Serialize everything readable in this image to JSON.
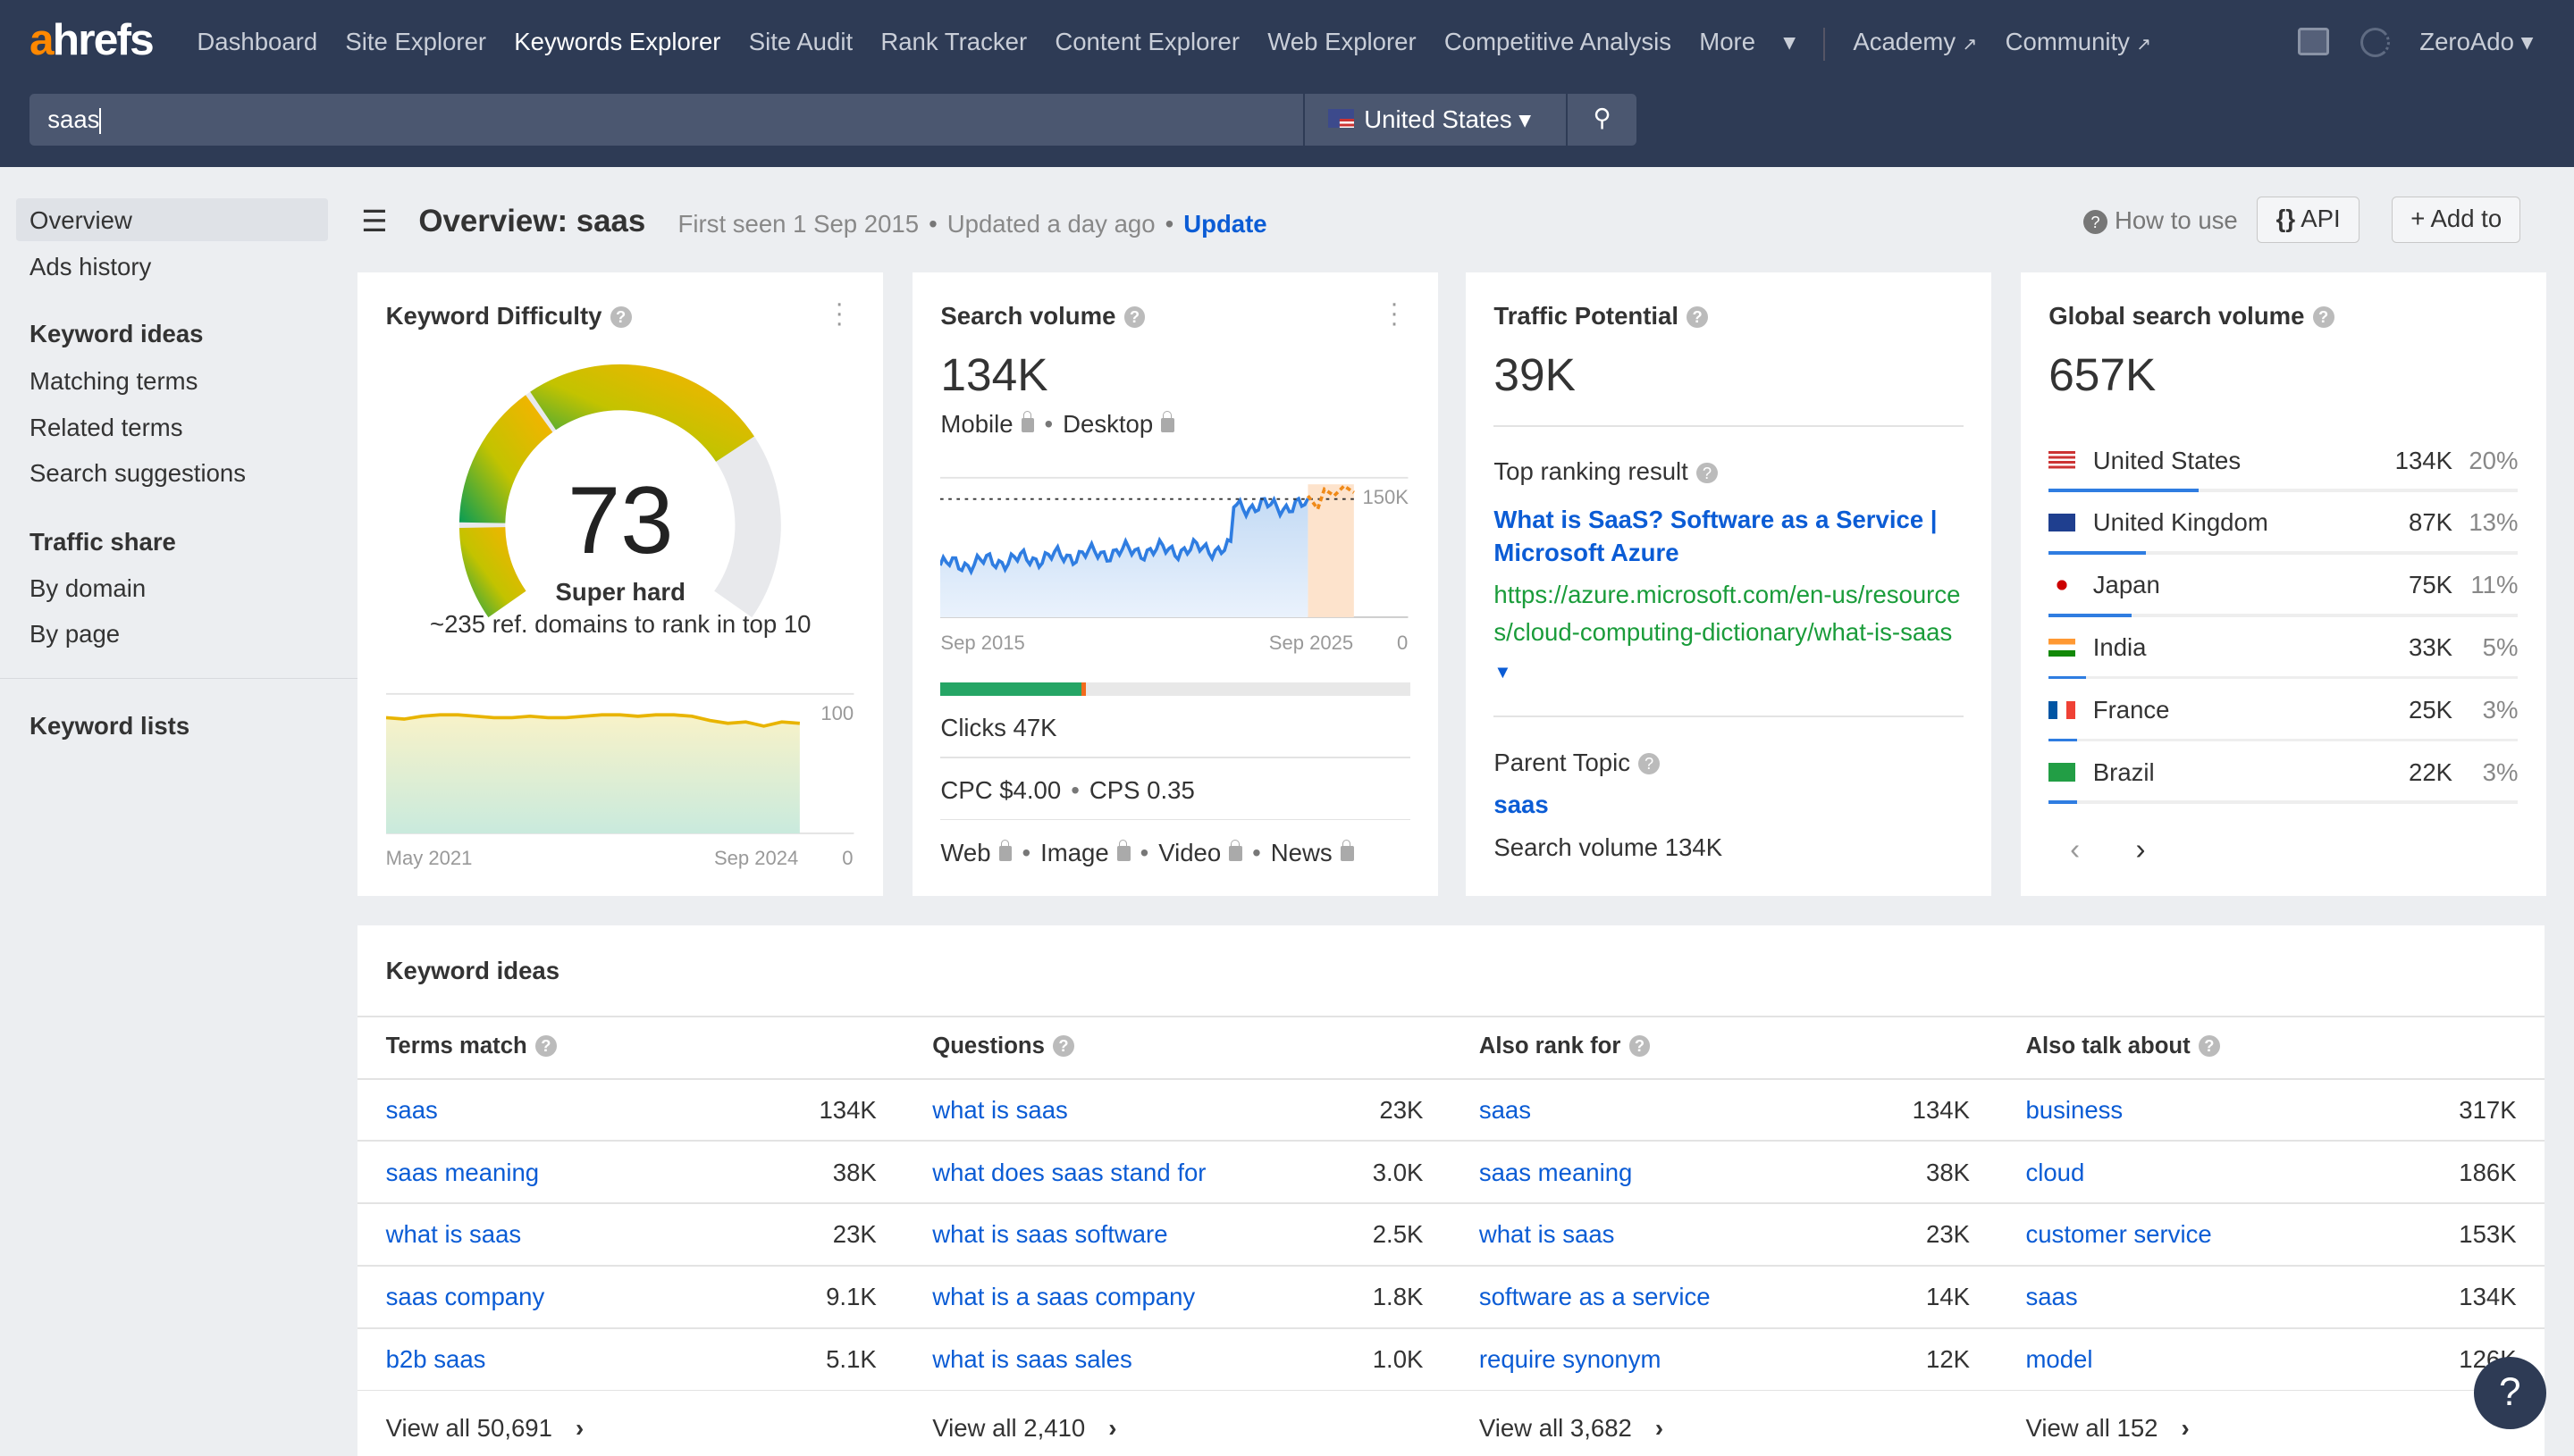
{
  "topbar": {
    "logo_accent": "a",
    "logo_rest": "hrefs",
    "nav": [
      "Dashboard",
      "Site Explorer",
      "Keywords Explorer",
      "Site Audit",
      "Rank Tracker",
      "Content Explorer",
      "Web Explorer",
      "Competitive Analysis",
      "More"
    ],
    "active": "Keywords Explorer",
    "academy": "Academy",
    "community": "Community",
    "user": "ZeroAdo"
  },
  "search": {
    "value": "saas",
    "country": "United States"
  },
  "sidebar": {
    "items": [
      "Overview",
      "Ads history"
    ],
    "g1": "Keyword ideas",
    "g1_items": [
      "Matching terms",
      "Related terms",
      "Search suggestions"
    ],
    "g2": "Traffic share",
    "g2_items": [
      "By domain",
      "By page"
    ],
    "g3": "Keyword lists"
  },
  "header": {
    "title": "Overview: saas",
    "first_seen": "First seen 1 Sep 2015",
    "updated": "Updated a day ago",
    "update": "Update",
    "how": "How to use",
    "api": "API",
    "add": "Add to"
  },
  "kd": {
    "title": "Keyword Difficulty",
    "value": "73",
    "score": 73,
    "label": "Super hard",
    "sub": "~235 ref. domains to rank in top 10",
    "x_start": "May 2021",
    "x_end": "Sep 2024",
    "y_max": "100",
    "y_min": "0",
    "history": [
      82,
      81,
      83,
      84,
      84,
      83,
      82,
      82,
      83,
      82,
      82,
      83,
      84,
      84,
      83,
      84,
      84,
      83,
      80,
      78,
      79,
      76,
      79,
      78
    ]
  },
  "sv": {
    "title": "Search volume",
    "value": "134K",
    "mobile": "Mobile",
    "desktop": "Desktop",
    "x_start": "Sep 2015",
    "x_end": "Sep 2025",
    "y_max": "150K",
    "y_min": "0",
    "clicks": "Clicks 47K",
    "clicks_green_pct": 30,
    "clicks_orange_pct": 1,
    "cpc": "CPC $4.00",
    "cps": "CPS 0.35",
    "serp": [
      "Web",
      "Image",
      "Video",
      "News"
    ]
  },
  "tp": {
    "title": "Traffic Potential",
    "value": "39K",
    "top_label": "Top ranking result",
    "result_title": "What is SaaS? Software as a Service | Microsoft Azure",
    "result_url": "https://azure.microsoft.com/en-us/resources/cloud-computing-dictionary/what-is-saas",
    "parent_label": "Parent Topic",
    "parent": "saas",
    "parent_sv": "Search volume 134K"
  },
  "gsv": {
    "title": "Global search volume",
    "value": "657K",
    "countries": [
      {
        "name": "United States",
        "v": "134K",
        "p": "20%",
        "share": 20
      },
      {
        "name": "United Kingdom",
        "v": "87K",
        "p": "13%",
        "share": 13
      },
      {
        "name": "Japan",
        "v": "75K",
        "p": "11%",
        "share": 11
      },
      {
        "name": "India",
        "v": "33K",
        "p": "5%",
        "share": 5
      },
      {
        "name": "France",
        "v": "25K",
        "p": "3%",
        "share": 3
      },
      {
        "name": "Brazil",
        "v": "22K",
        "p": "3%",
        "share": 3
      }
    ]
  },
  "ideas": {
    "title": "Keyword ideas",
    "cols": [
      {
        "h": "Terms match",
        "rows": [
          [
            "saas",
            "134K"
          ],
          [
            "saas meaning",
            "38K"
          ],
          [
            "what is saas",
            "23K"
          ],
          [
            "saas company",
            "9.1K"
          ],
          [
            "b2b saas",
            "5.1K"
          ]
        ],
        "all": "View all 50,691"
      },
      {
        "h": "Questions",
        "rows": [
          [
            "what is saas",
            "23K"
          ],
          [
            "what does saas stand for",
            "3.0K"
          ],
          [
            "what is saas software",
            "2.5K"
          ],
          [
            "what is a saas company",
            "1.8K"
          ],
          [
            "what is saas sales",
            "1.0K"
          ]
        ],
        "all": "View all 2,410"
      },
      {
        "h": "Also rank for",
        "rows": [
          [
            "saas",
            "134K"
          ],
          [
            "saas meaning",
            "38K"
          ],
          [
            "what is saas",
            "23K"
          ],
          [
            "software as a service",
            "14K"
          ],
          [
            "require synonym",
            "12K"
          ]
        ],
        "all": "View all 3,682"
      },
      {
        "h": "Also talk about",
        "rows": [
          [
            "business",
            "317K"
          ],
          [
            "cloud",
            "186K"
          ],
          [
            "customer service",
            "153K"
          ],
          [
            "saas",
            "134K"
          ],
          [
            "model",
            "126K"
          ]
        ],
        "all": "View all 152"
      }
    ]
  },
  "help": "?"
}
